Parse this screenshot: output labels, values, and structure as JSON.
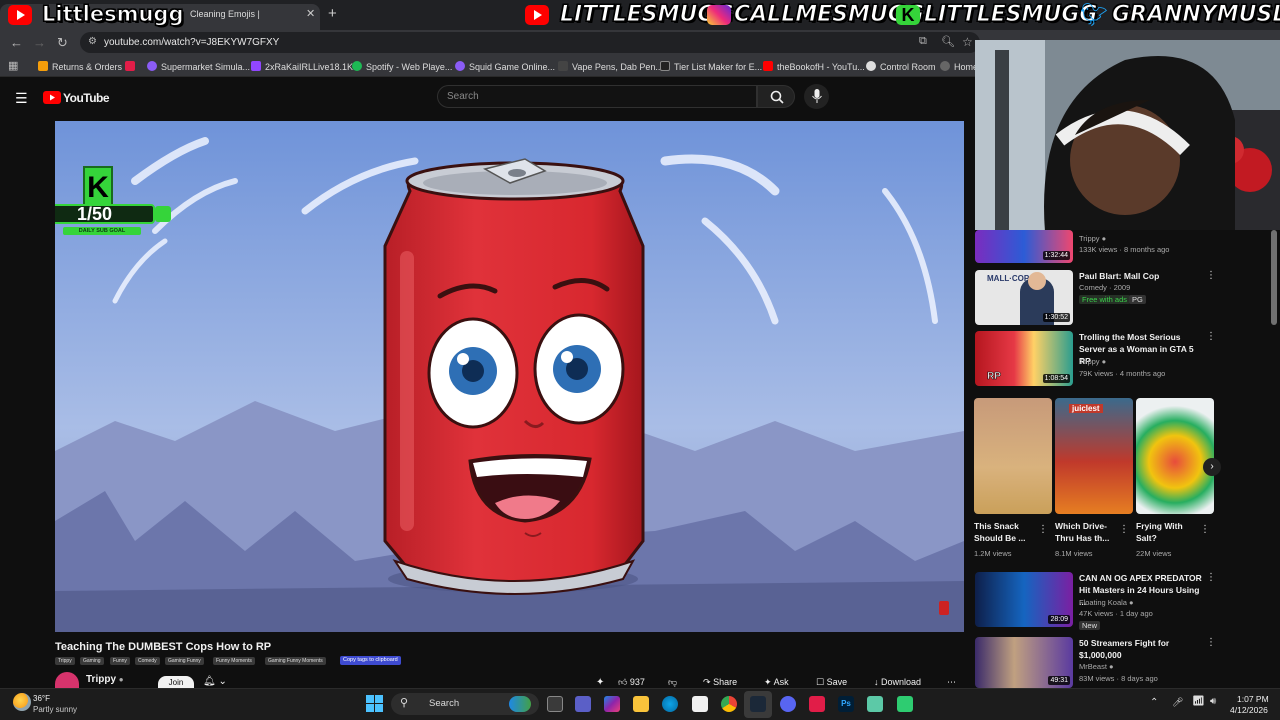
{
  "browser": {
    "tab_title": "Cleaning Emojis |",
    "url": "youtube.com/watch?v=J8EKYW7GFXY",
    "bookmarks": [
      "Returns & Orders",
      "Supermarket Simula...",
      "2xRaKaiIRLLive18.1K...",
      "Spotify - Web Playe...",
      "Squid Game Online...",
      "Vape Pens, Dab Pen...",
      "Tier List Maker for E...",
      "theBookofH - YouTu...",
      "Control Room",
      "Home"
    ]
  },
  "overlay": {
    "handles": [
      "Littlesmugg",
      "LITTLESMUGG",
      "CALLMESMUGG",
      "LITTLESMUGG",
      "GRANNYMUSLIM"
    ],
    "sub_goal_count": "1/50",
    "sub_goal_label": "DAILY SUB GOAL"
  },
  "youtube": {
    "logo": "YouTube",
    "search_placeholder": "Search",
    "video": {
      "title": "Teaching The DUMBEST Cops How to RP",
      "tags": [
        "Trippy",
        "Gaming",
        "Funny",
        "Comedy",
        "Gaming Funny",
        "Funny Moments",
        "Gaming Funny Moments"
      ],
      "copy_tags": "Copy tags to clipboard",
      "channel": "Trippy",
      "join": "Join",
      "likes": "937",
      "share": "Share",
      "ask": "Ask",
      "save": "Save",
      "download": "Download"
    },
    "related": [
      {
        "title": "",
        "channel": "Trippy",
        "meta": "133K views · 8 months ago",
        "duration": "1:32:44"
      },
      {
        "title": "Paul Blart: Mall Cop",
        "channel": "Comedy · 2009",
        "meta": "Free with ads",
        "badge": "PG",
        "duration": "1:30:52"
      },
      {
        "title": "Trolling the Most Serious Server as a Woman in GTA 5 RP",
        "channel": "Trippy",
        "meta": "79K views · 4 months ago",
        "duration": "1:08:54"
      },
      {
        "title": "CAN AN OG APEX PREDATOR Hit Masters in 24 Hours Using ...",
        "channel": "Floating Koala",
        "meta": "47K views · 1 day ago",
        "badge": "New",
        "duration": "28:09"
      },
      {
        "title": "50 Streamers Fight for $1,000,000",
        "channel": "MrBeast",
        "meta": "83M views · 8 days ago",
        "duration": "49:31"
      }
    ],
    "shorts": [
      {
        "title": "This Snack Should Be ...",
        "views": "1.2M views"
      },
      {
        "title": "Which Drive-Thru Has th...",
        "views": "8.1M views",
        "overlay": "juiclest"
      },
      {
        "title": "Frying With Salt?",
        "views": "22M views"
      }
    ],
    "paul_blart_thumb_text": "MALL·COP"
  },
  "taskbar": {
    "weather_temp": "36°F",
    "weather_desc": "Partly sunny",
    "search": "Search",
    "time": "1:07 PM",
    "date": "4/12/2026"
  },
  "colors": {
    "yt_red": "#ff0000",
    "can_red": "#e0323a",
    "sky": "#8ea7dc",
    "goal_green": "#35d43a"
  }
}
